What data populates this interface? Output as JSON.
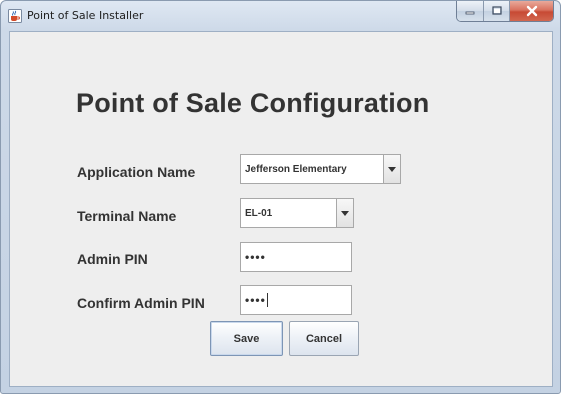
{
  "window": {
    "title": "Point of Sale Installer",
    "icon": "java-cup-icon"
  },
  "form": {
    "heading": "Point of Sale Configuration",
    "application_name": {
      "label": "Application Name",
      "value": "Jefferson Elementary"
    },
    "terminal_name": {
      "label": "Terminal Name",
      "value": "EL-01"
    },
    "admin_pin": {
      "label": "Admin PIN",
      "value": "••••"
    },
    "confirm_admin_pin": {
      "label": "Confirm Admin PIN",
      "value": "••••"
    }
  },
  "buttons": {
    "save_label": "Save",
    "cancel_label": "Cancel"
  },
  "colors": {
    "client_background": "#eeeeee",
    "text": "#333333",
    "close_button": "#c74a35"
  }
}
